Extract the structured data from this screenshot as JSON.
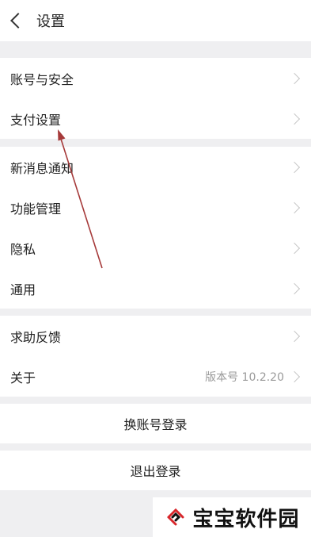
{
  "header": {
    "title": "设置"
  },
  "groups": [
    {
      "items": [
        {
          "label": "账号与安全"
        },
        {
          "label": "支付设置"
        }
      ]
    },
    {
      "items": [
        {
          "label": "新消息通知"
        },
        {
          "label": "功能管理"
        },
        {
          "label": "隐私"
        },
        {
          "label": "通用"
        }
      ]
    },
    {
      "items": [
        {
          "label": "求助反馈"
        },
        {
          "label": "关于",
          "value": "版本号 10.2.20"
        }
      ]
    }
  ],
  "actions": {
    "switch_account": "换账号登录",
    "logout": "退出登录"
  },
  "watermark": {
    "text": "宝宝软件园"
  },
  "colors": {
    "background": "#efeff1",
    "surface": "#ffffff",
    "annotation_arrow": "#a63a3a"
  }
}
